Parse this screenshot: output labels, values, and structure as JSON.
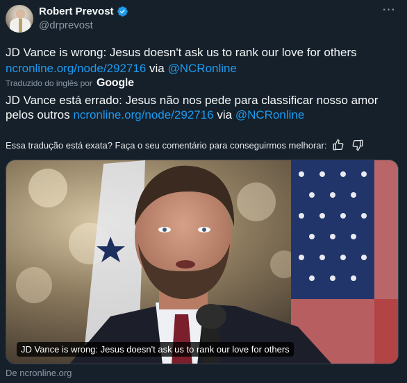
{
  "author": {
    "display_name": "Robert Prevost",
    "handle": "@drprevost"
  },
  "tweet": {
    "text": "JD Vance is wrong: Jesus doesn't ask us to rank our love for others",
    "link": "ncronline.org/node/292716",
    "via": "via",
    "mention": "@NCRonline"
  },
  "translation": {
    "label": "Traduzido do inglês por",
    "provider": "Google",
    "text": "JD Vance está errado: Jesus não nos pede para classificar nosso amor pelos outros",
    "link": "ncronline.org/node/292716",
    "via": "via",
    "mention": "@NCRonline"
  },
  "feedback": {
    "question": "Essa tradução está exata? Faça o seu comentário para conseguirmos melhorar:"
  },
  "media": {
    "caption": "JD Vance is wrong: Jesus doesn't ask us to rank our love for others",
    "source": "De ncronline.org"
  },
  "icons": {
    "verified": "verified-badge-icon",
    "more": "more-options-icon",
    "thumbs_up": "thumbs-up-icon",
    "thumbs_down": "thumbs-down-icon"
  },
  "colors": {
    "background": "#15202b",
    "link": "#1d9bf0",
    "secondary_text": "#8b98a5"
  }
}
